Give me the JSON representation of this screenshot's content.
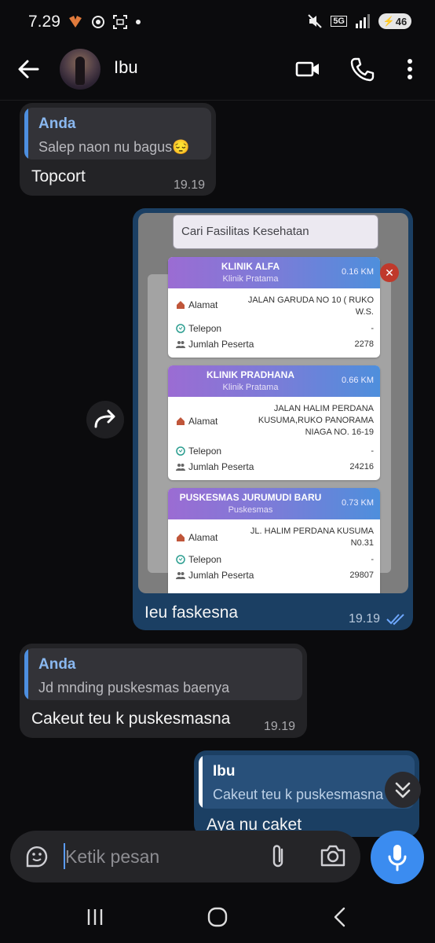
{
  "status_bar": {
    "time": "7.29",
    "network": "5G",
    "battery": "46"
  },
  "header": {
    "contact_name": "Ibu"
  },
  "messages": {
    "m1": {
      "quote_name": "Anda",
      "quote_text": "Salep naon nu bagus😔",
      "text": "Topcort",
      "time": "19.19"
    },
    "m2": {
      "caption": "Ieu faskesna",
      "time": "19.19",
      "image": {
        "search_placeholder": "Cari Fasilitas Kesehatan",
        "facilities": [
          {
            "name": "KLINIK ALFA",
            "type": "Klinik Pratama",
            "distance": "0.16 KM",
            "alamat_label": "Alamat",
            "alamat": "JALAN GARUDA NO 10 ( RUKO W.S.",
            "telepon_label": "Telepon",
            "telepon": "-",
            "peserta_label": "Jumlah Peserta",
            "peserta": "2278"
          },
          {
            "name": "KLINIK PRADHANA",
            "type": "Klinik Pratama",
            "distance": "0.66 KM",
            "alamat_label": "Alamat",
            "alamat": "JALAN HALIM PERDANA KUSUMA,RUKO PANORAMA NIAGA NO. 16-19",
            "telepon_label": "Telepon",
            "telepon": "-",
            "peserta_label": "Jumlah Peserta",
            "peserta": "24216"
          },
          {
            "name": "PUSKESMAS JURUMUDI BARU",
            "type": "Puskesmas",
            "distance": "0.73 KM",
            "alamat_label": "Alamat",
            "alamat": "JL. HALIM PERDANA KUSUMA N0.31",
            "telepon_label": "Telepon",
            "telepon": "-",
            "peserta_label": "Jumlah Peserta",
            "peserta": "29807"
          }
        ]
      }
    },
    "m3": {
      "quote_name": "Anda",
      "quote_text": "Jd mnding puskesmas baenya",
      "text": "Cakeut teu k puskesmasna",
      "time": "19.19"
    },
    "m4": {
      "quote_name": "Ibu",
      "quote_text": "Cakeut teu k puskesmasna",
      "text": "Aya nu caket"
    }
  },
  "input": {
    "placeholder": "Ketik pesan"
  },
  "colors": {
    "incoming_bubble": "#232326",
    "outgoing_bubble": "#1b3f63",
    "accent": "#3b8cf0",
    "quote_name": "#8ab8f0"
  }
}
